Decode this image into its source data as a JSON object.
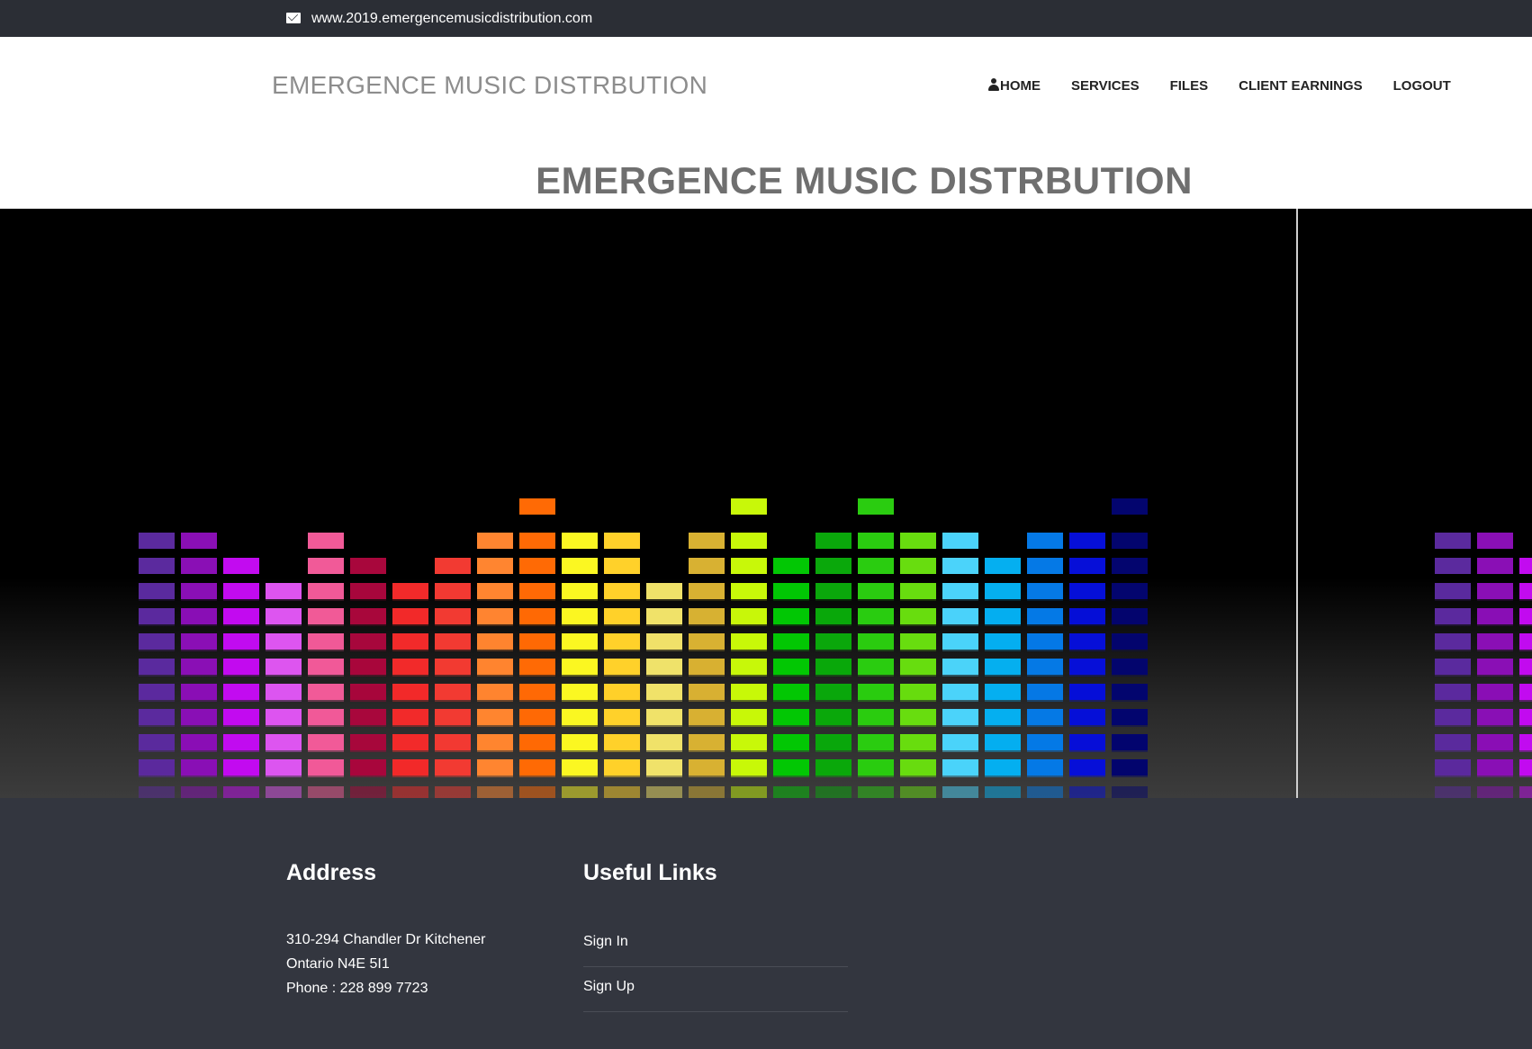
{
  "topbar": {
    "email_icon": "envelope-icon",
    "url": "www.2019.emergencemusicdistribution.com"
  },
  "header": {
    "brand": "EMERGENCE MUSIC DISTRBUTION",
    "nav": {
      "home_icon": "user-icon",
      "home": "HOME",
      "services": "SERVICES",
      "files": "FILES",
      "client_earnings": "CLIENT EARNINGS",
      "logout": "LOGOUT"
    }
  },
  "hero": {
    "title": "EMERGENCE MUSIC DISTRBUTION",
    "image": "equalizer-bars-image"
  },
  "colors": {
    "topbar_bg": "#2b2e35",
    "footer_bg": "#33363f",
    "equalizer": [
      "#5b2a9e",
      "#8a0fb5",
      "#c20bf0",
      "#dd55f0",
      "#f15a98",
      "#a8073c",
      "#f22a2a",
      "#f23a32",
      "#ff8530",
      "#ff6a05",
      "#fbf722",
      "#ffd12a",
      "#f0e26a",
      "#d8b132",
      "#c8f809",
      "#02c704",
      "#0aa80b",
      "#2acc10",
      "#68dd0f",
      "#4bd3fa",
      "#05aff0",
      "#0579e6",
      "#060fd8",
      "#03056e"
    ]
  },
  "footer": {
    "address": {
      "title": "Address",
      "line1": "310-294 Chandler Dr Kitchener",
      "line2": "Ontario N4E 5I1",
      "phone": "Phone : 228 899 7723"
    },
    "useful_links": {
      "title": "Useful Links",
      "items": [
        "Sign In",
        "Sign Up"
      ]
    }
  }
}
